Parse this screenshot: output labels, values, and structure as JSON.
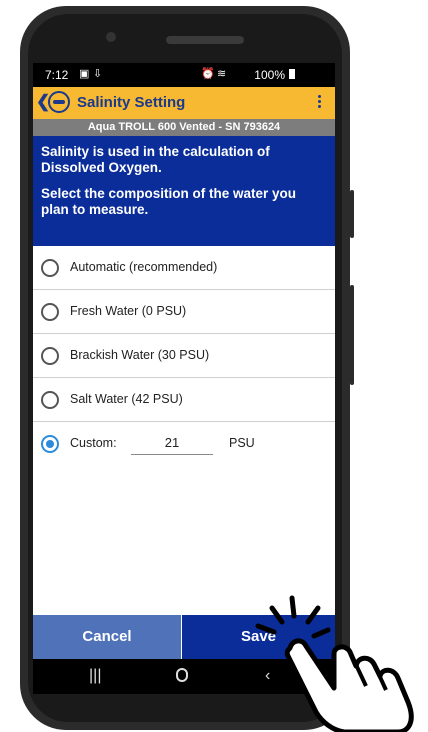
{
  "status_bar": {
    "time": "7:12",
    "right": "100%"
  },
  "app_bar": {
    "title": "Salinity Setting"
  },
  "device_label": "Aqua TROLL 600 Vented - SN 793624",
  "info": {
    "line1": "Salinity is used in the calculation of Dissolved Oxygen.",
    "line2": "Select the composition of the water you plan to measure."
  },
  "options": [
    {
      "label": "Automatic (recommended)",
      "selected": false
    },
    {
      "label": "Fresh Water (0 PSU)",
      "selected": false
    },
    {
      "label": "Brackish Water (30 PSU)",
      "selected": false
    },
    {
      "label": "Salt Water (42 PSU)",
      "selected": false
    },
    {
      "label": "Custom:",
      "selected": true,
      "value": "21",
      "unit": "PSU"
    }
  ],
  "buttons": {
    "cancel": "Cancel",
    "save": "Save"
  },
  "colors": {
    "accent_yellow": "#F7B832",
    "primary_blue": "#0B2D9A",
    "cancel_blue": "#4F72B8",
    "radio_selected": "#2E8BDB"
  }
}
